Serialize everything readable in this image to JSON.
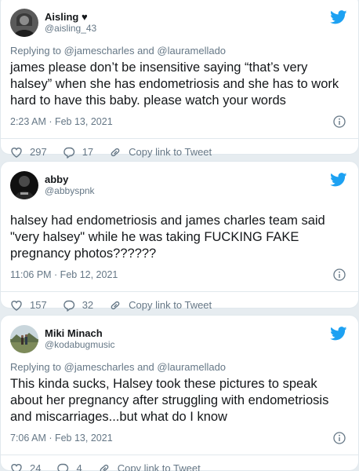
{
  "colors": {
    "twitter_blue": "#1da1f2",
    "heart": "#657786",
    "text": "#14171a",
    "muted": "#657786"
  },
  "tweets": [
    {
      "name": "Aisling ♥",
      "handle": "@aisling_43",
      "replying_prefix": "Replying to",
      "reply_user_1": "@jamescharles",
      "reply_and": "and",
      "reply_user_2": "@lauramellado",
      "text": "james please don’t be insensitive saying “that’s very halsey” when she has endometriosis and she has to work hard to have this baby. please watch your words",
      "timestamp": "2:23 AM · Feb 13, 2021",
      "likes": "297",
      "replies": "17",
      "copy_link": "Copy link to Tweet"
    },
    {
      "name": "abby",
      "handle": "@abbyspnk",
      "text": "halsey had endometriosis and james charles team said \"very halsey\" while he was taking FUCKING FAKE pregnancy photos??????",
      "timestamp": "11:06 PM · Feb 12, 2021",
      "likes": "157",
      "replies": "32",
      "copy_link": "Copy link to Tweet"
    },
    {
      "name": "Miki Minach",
      "handle": "@kodabugmusic",
      "replying_prefix": "Replying to",
      "reply_user_1": "@jamescharles",
      "reply_and": "and",
      "reply_user_2": "@lauramellado",
      "text": "This kinda sucks, Halsey took these pictures to speak about her pregnancy after struggling with endometriosis and miscarriages...but what do I know",
      "timestamp": "7:06 AM · Feb 13, 2021",
      "likes": "24",
      "replies": "4",
      "copy_link": "Copy link to Tweet"
    }
  ]
}
